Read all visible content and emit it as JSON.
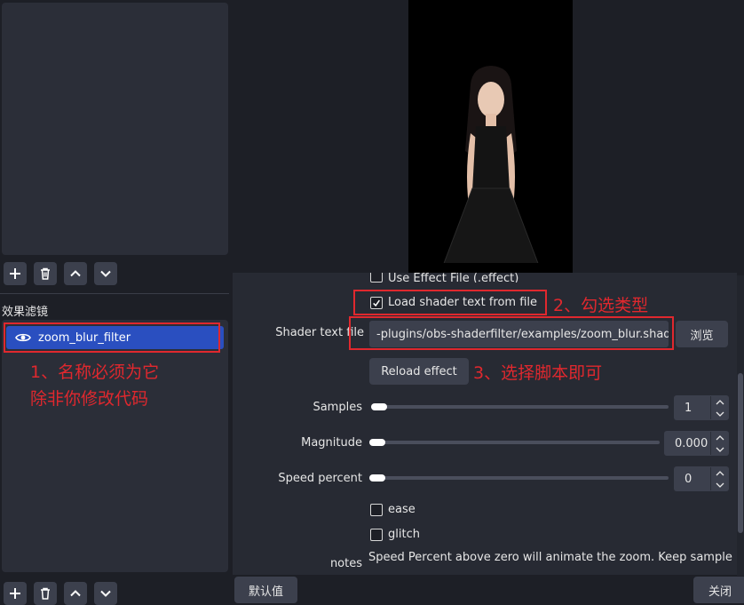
{
  "left": {
    "filters_section_label": "效果滤镜",
    "filter_item": "zoom_blur_filter"
  },
  "annotations": {
    "note1_line1": "1、名称必须为它",
    "note1_line2": "除非你修改代码",
    "note2": "2、勾选类型",
    "note3": "3、选择脚本即可"
  },
  "props": {
    "use_effect_file": "Use Effect File (.effect)",
    "load_shader_text": "Load shader text from file",
    "shader_text_file_label": "Shader text file",
    "shader_path": "-plugins/obs-shaderfilter/examples/zoom_blur.shader",
    "browse_button": "浏览",
    "reload_button": "Reload effect",
    "samples_label": "Samples",
    "samples_value": "1",
    "magnitude_label": "Magnitude",
    "magnitude_value": "0.000",
    "speed_label": "Speed percent",
    "speed_value": "0",
    "ease_label": "ease",
    "glitch_label": "glitch",
    "notes_label": "notes",
    "notes_text": "Speed Percent above zero will animate the zoom. Keep samples"
  },
  "bottom": {
    "defaults_button": "默认值",
    "close_button": "关闭"
  },
  "colors": {
    "accent": "#2a4fc0",
    "annotation_red": "#e0282e"
  }
}
